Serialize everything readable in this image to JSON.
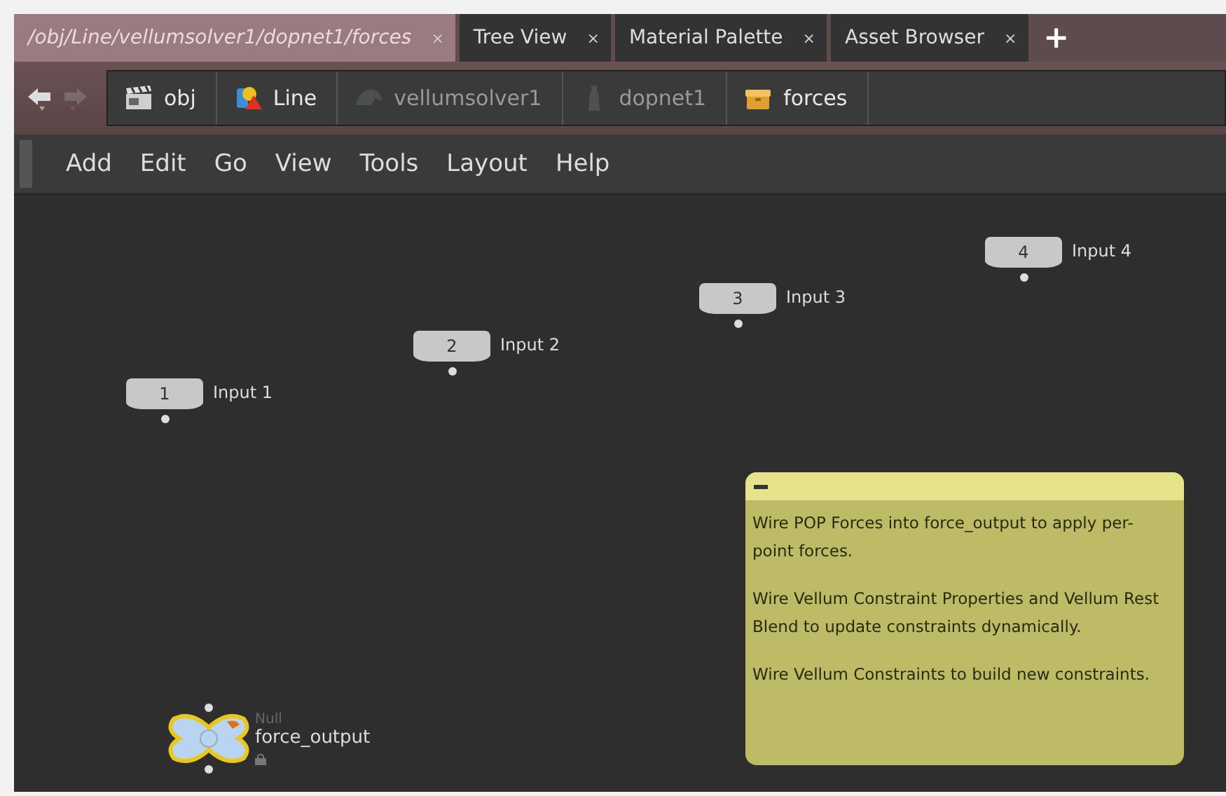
{
  "tabs": [
    {
      "label": "/obj/Line/vellumsolver1/dopnet1/forces",
      "close": "×",
      "selected": true
    },
    {
      "label": "Tree View",
      "close": "×",
      "selected": false
    },
    {
      "label": "Material Palette",
      "close": "×",
      "selected": false
    },
    {
      "label": "Asset Browser",
      "close": "×",
      "selected": false
    }
  ],
  "new_tab": "+",
  "navigation": {
    "back_disabled": false,
    "forward_disabled": true
  },
  "breadcrumbs": [
    {
      "label": "obj",
      "kind": "obj",
      "dimmed": false
    },
    {
      "label": "Line",
      "kind": "geo",
      "dimmed": false
    },
    {
      "label": "vellumsolver1",
      "kind": "solver",
      "dimmed": true
    },
    {
      "label": "dopnet1",
      "kind": "dop",
      "dimmed": true
    },
    {
      "label": "forces",
      "kind": "box",
      "dimmed": false
    }
  ],
  "menu": [
    "Add",
    "Edit",
    "Go",
    "View",
    "Tools",
    "Layout",
    "Help"
  ],
  "inputs": [
    {
      "number": "1",
      "label": "Input 1"
    },
    {
      "number": "2",
      "label": "Input 2"
    },
    {
      "number": "3",
      "label": "Input 3"
    },
    {
      "number": "4",
      "label": "Input 4"
    }
  ],
  "output_node": {
    "type": "Null",
    "name": "force_output",
    "selected": true
  },
  "sticky_note": {
    "paragraphs": [
      "Wire POP Forces into force_output to apply per-point forces.",
      "Wire Vellum Constraint Properties and Vellum Rest Blend to update constraints dynamically.",
      "Wire Vellum Constraints to build new constraints."
    ]
  }
}
